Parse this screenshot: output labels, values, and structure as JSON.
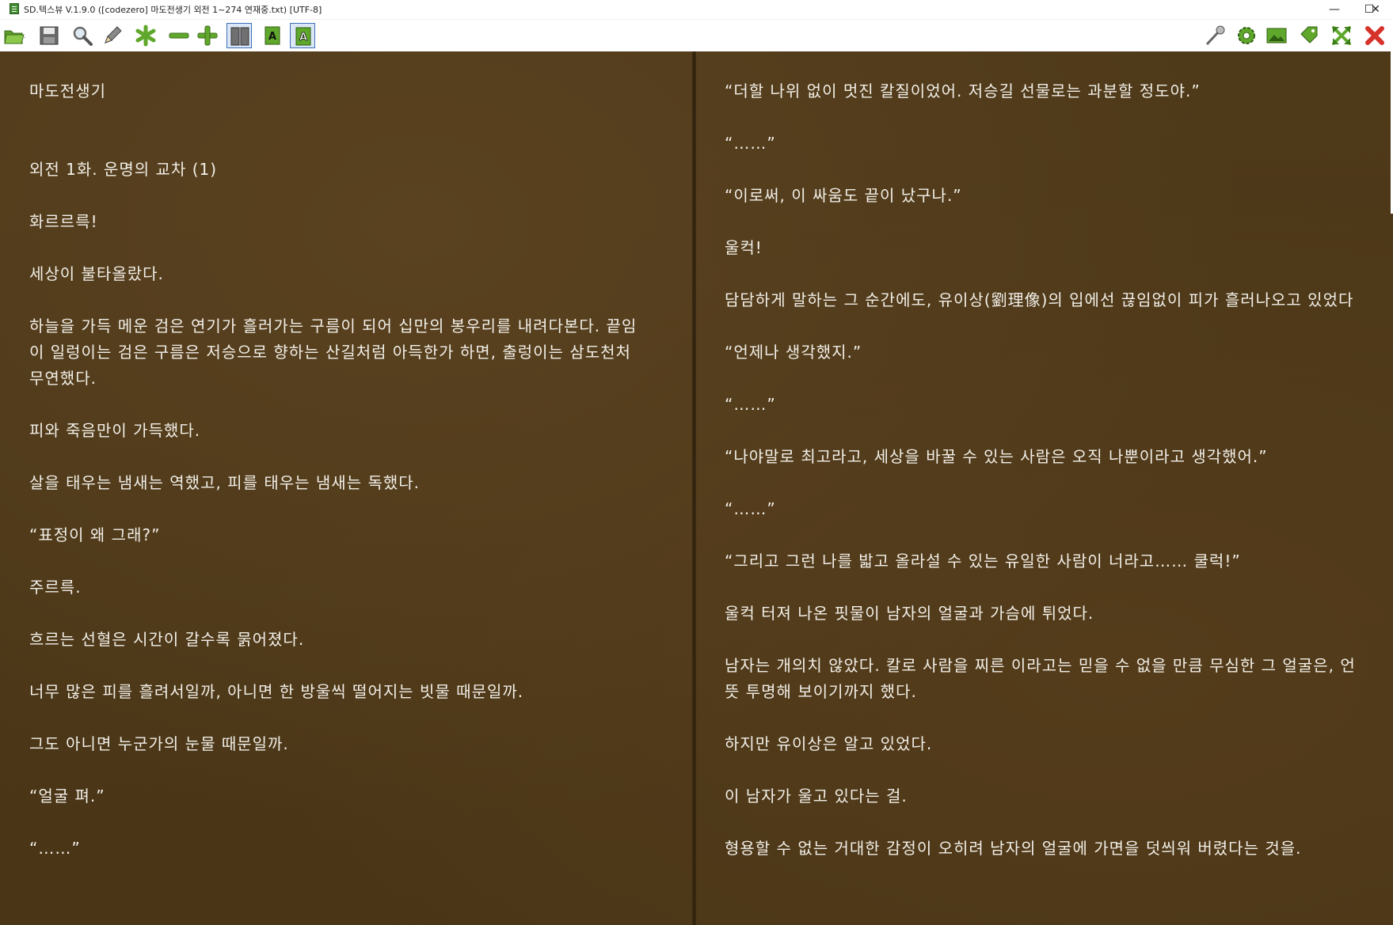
{
  "window": {
    "title": "SD.텍스뷰 V.1.9.0 ([codezero] 마도전생기 외전 1~274 연재중.txt) [UTF-8]",
    "minimize": "—",
    "maximize": "☐",
    "close": "✕"
  },
  "toolbar": {
    "icons": [
      "folder-open-icon",
      "save-icon",
      "search-icon",
      "pencil-icon",
      "asterisk-icon",
      "minus-icon",
      "plus-icon",
      "two-page-icon",
      "text-a-icon",
      "text-a-outline-icon",
      "wrench-icon",
      "gear-icon",
      "image-icon",
      "tag-icon",
      "fullscreen-icon",
      "close-icon"
    ],
    "accent": "#6fb33a"
  },
  "left_page": [
    "마도전생기",
    "",
    "",
    "외전 1화. 운명의 교차 (1)",
    "",
    "화르르륵!",
    "",
    "세상이 불타올랐다.",
    "",
    "하늘을 가득 메운 검은 연기가 흘러가는 구름이 되어 십만의 봉우리를 내려다본다. 끝임",
    "이 일렁이는 검은 구름은 저승으로 향하는 산길처럼 아득한가 하면, 출렁이는 삼도천처",
    "무연했다.",
    "",
    "피와 죽음만이 가득했다.",
    "",
    "살을 태우는 냄새는 역했고, 피를 태우는 냄새는 독했다.",
    "",
    "“표정이 왜 그래?”",
    "",
    "주르륵.",
    "",
    "흐르는 선혈은 시간이 갈수록 묽어졌다.",
    "",
    "너무 많은 피를 흘려서일까, 아니면 한 방울씩 떨어지는 빗물 때문일까.",
    "",
    "그도 아니면 누군가의 눈물 때문일까.",
    "",
    "“얼굴 펴.”",
    "",
    "“……”"
  ],
  "right_page": [
    "“더할 나위 없이 멋진 칼질이었어. 저승길 선물로는 과분할 정도야.”",
    "",
    "“……”",
    "",
    "“이로써, 이 싸움도 끝이 났구나.”",
    "",
    "울컥!",
    "",
    "담담하게 말하는 그 순간에도, 유이상(劉理像)의 입에선 끊임없이 피가 흘러나오고 있었다",
    "",
    "“언제나 생각했지.”",
    "",
    "“……”",
    "",
    "“나야말로 최고라고, 세상을 바꿀 수 있는 사람은 오직 나뿐이라고 생각했어.”",
    "",
    "“……”",
    "",
    "“그리고 그런 나를 밟고 올라설 수 있는 유일한 사람이 너라고…… 쿨럭!”",
    "",
    "울컥 터져 나온 핏물이 남자의 얼굴과 가슴에 튀었다.",
    "",
    "남자는 개의치 않았다. 칼로 사람을 찌른 이라고는 믿을 수 없을 만큼 무심한 그 얼굴은, 언",
    "뜻 투명해 보이기까지 했다.",
    "",
    "하지만 유이상은 알고 있었다.",
    "",
    "이 남자가 울고 있다는 걸.",
    "",
    "형용할 수 없는 거대한 감정이 오히려 남자의 얼굴에 가면을 덧씌워 버렸다는 것을."
  ]
}
